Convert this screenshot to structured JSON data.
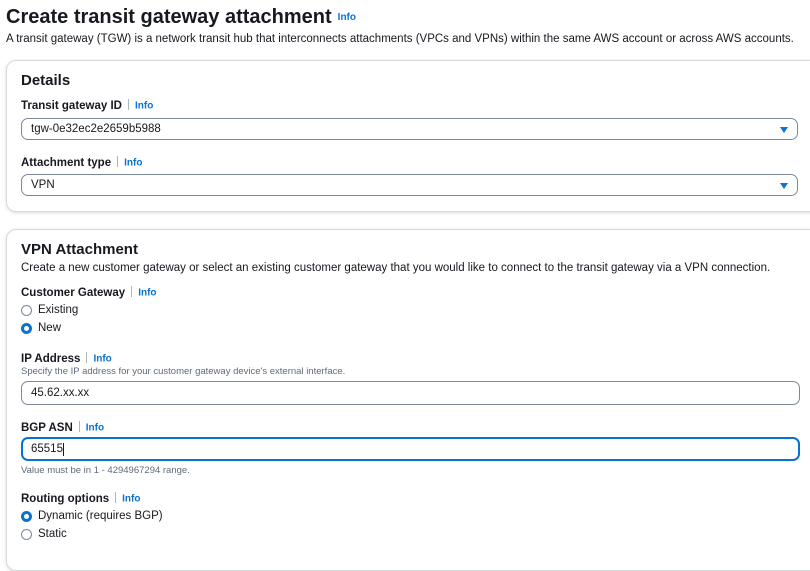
{
  "page": {
    "title": "Create transit gateway attachment",
    "info": "Info",
    "description": "A transit gateway (TGW) is a network transit hub that interconnects attachments (VPCs and VPNs) within the same AWS account or across AWS accounts."
  },
  "details": {
    "title": "Details",
    "tgw_label": "Transit gateway ID",
    "tgw_info": "Info",
    "tgw_value": "tgw-0e32ec2e2659b5988",
    "attach_label": "Attachment type",
    "attach_info": "Info",
    "attach_value": "VPN"
  },
  "vpn": {
    "title": "VPN Attachment",
    "description": "Create a new customer gateway or select an existing customer gateway that you would like to connect to the transit gateway via a VPN connection.",
    "cgw_label": "Customer Gateway",
    "cgw_info": "Info",
    "cgw_options": [
      {
        "label": "Existing",
        "checked": false
      },
      {
        "label": "New",
        "checked": true
      }
    ],
    "ip_label": "IP Address",
    "ip_info": "Info",
    "ip_hint": "Specify the IP address for your customer gateway device's external interface.",
    "ip_value": "45.62.xx.xx",
    "asn_label": "BGP ASN",
    "asn_info": "Info",
    "asn_value": "65515",
    "asn_hint": "Value must be in 1 - 4294967294 range.",
    "routing_label": "Routing options",
    "routing_info": "Info",
    "routing_options": [
      {
        "label": "Dynamic (requires BGP)",
        "checked": true
      },
      {
        "label": "Static",
        "checked": false
      }
    ]
  },
  "colors": {
    "accent": "#0972d3",
    "border": "#7d8998",
    "text": "#16191f",
    "hint": "#5f6b7a"
  }
}
